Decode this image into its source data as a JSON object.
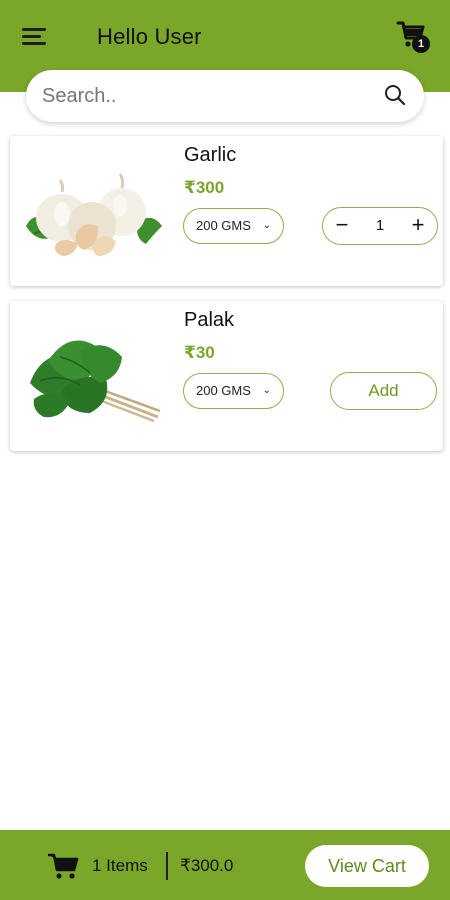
{
  "colors": {
    "brand_green": "#7aa62a",
    "price_green": "#7aa62a",
    "outline_green": "#8fae4e"
  },
  "header": {
    "greeting": "Hello User",
    "menu_icon": "hamburger-menu-icon",
    "cart_icon": "cart-icon",
    "cart_badge_count": "1"
  },
  "search": {
    "placeholder": "Search..",
    "value": "",
    "icon": "search-icon"
  },
  "products": [
    {
      "name": "Garlic",
      "price": "₹300",
      "weight": "200 GMS",
      "weight_chevron": "⌄",
      "quantity": "1",
      "minus_label": "−",
      "plus_label": "+",
      "in_cart": true,
      "image": "garlic-image"
    },
    {
      "name": "Palak",
      "price": "₹30",
      "weight": "200 GMS",
      "weight_chevron": "⌄",
      "add_label": "Add",
      "in_cart": false,
      "image": "spinach-image"
    }
  ],
  "bottom_bar": {
    "items_count": "1 Items",
    "total": "₹300.0",
    "view_cart_label": "View Cart",
    "cart_icon": "cart-icon"
  }
}
